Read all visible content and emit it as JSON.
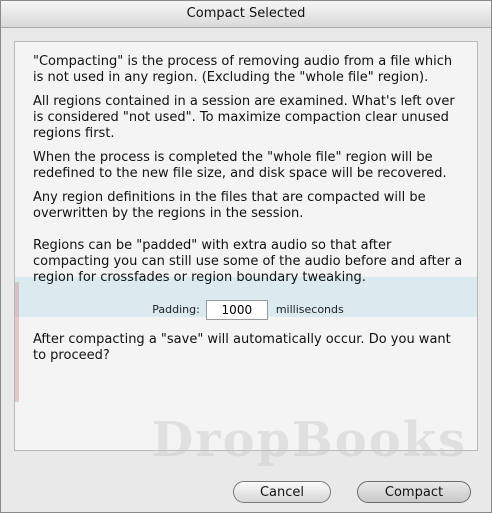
{
  "window": {
    "title": "Compact Selected"
  },
  "dialog": {
    "paragraphs": [
      "\"Compacting\" is the process of removing audio from a file which is not used in any region.  (Excluding the \"whole file\" region).",
      "All regions contained in a session are examined.  What's left over is considered \"not used\".  To maximize compaction clear unused regions first.",
      "When the process is completed the \"whole file\" region will be redefined to the new file size, and disk space will be recovered.",
      "Any region definitions in the files that are compacted will be overwritten by the regions in the session.",
      "Regions can be \"padded\" with extra audio so that after compacting you can still use some of the audio before and after a region for crossfades or region boundary tweaking."
    ],
    "padding_label": "Padding:",
    "padding_value": "1000",
    "padding_unit": "milliseconds",
    "closing_text": "After compacting a \"save\" will automatically occur.  Do you want to proceed?"
  },
  "buttons": {
    "cancel": "Cancel",
    "compact": "Compact"
  },
  "watermark": "DropBooks"
}
